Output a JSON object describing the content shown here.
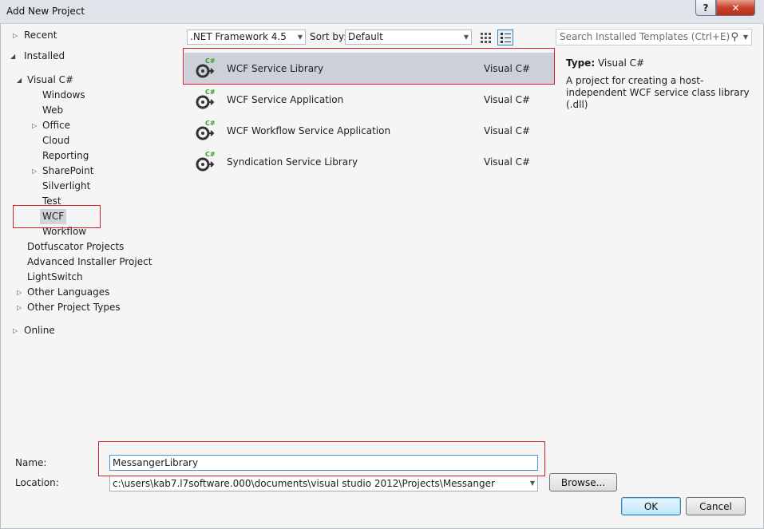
{
  "window": {
    "title": "Add New Project",
    "help_glyph": "?",
    "close_glyph": "✕"
  },
  "tree": {
    "recent": "Recent",
    "installed": "Installed",
    "visual_csharp": "Visual C#",
    "items": [
      "Windows",
      "Web",
      "Office",
      "Cloud",
      "Reporting",
      "SharePoint",
      "Silverlight",
      "Test",
      "WCF",
      "Workflow"
    ],
    "dotfuscator": "Dotfuscator Projects",
    "advanced_installer": "Advanced Installer Project",
    "lightswitch": "LightSwitch",
    "other_languages": "Other Languages",
    "other_project_types": "Other Project Types",
    "online": "Online"
  },
  "toolbar": {
    "framework": ".NET Framework 4.5",
    "sort_label": "Sort by:",
    "sort_value": "Default"
  },
  "templates": [
    {
      "name": "WCF Service Library",
      "lang": "Visual C#"
    },
    {
      "name": "WCF Service Application",
      "lang": "Visual C#"
    },
    {
      "name": "WCF Workflow Service Application",
      "lang": "Visual C#"
    },
    {
      "name": "Syndication Service Library",
      "lang": "Visual C#"
    }
  ],
  "icon_badge": "C#",
  "search": {
    "placeholder": "Search Installed Templates (Ctrl+E)"
  },
  "details": {
    "type_label": "Type:",
    "type_value": "Visual C#",
    "description": "A project for creating a host-independent WCF service class library (.dll)"
  },
  "form": {
    "name_label": "Name:",
    "name_value": "MessangerLibrary",
    "location_label": "Location:",
    "location_value": "c:\\users\\kab7.l7software.000\\documents\\visual studio 2012\\Projects\\Messanger",
    "browse": "Browse...",
    "ok": "OK",
    "cancel": "Cancel"
  },
  "colors": {
    "selection": "#cdd0d8",
    "annotation": "#d2202a",
    "accent": "#3c7fb1"
  }
}
